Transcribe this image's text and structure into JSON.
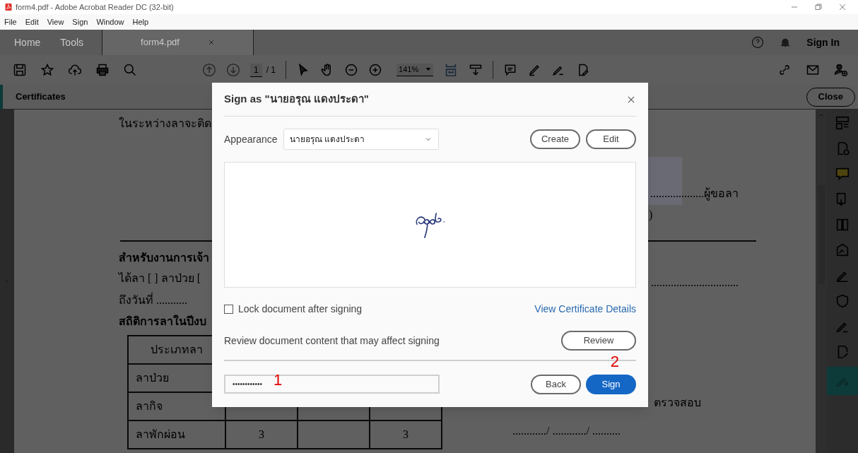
{
  "window": {
    "title": "form4.pdf - Adobe Acrobat Reader DC (32-bit)"
  },
  "menu": [
    "File",
    "Edit",
    "View",
    "Sign",
    "Window",
    "Help"
  ],
  "nav_tabs": [
    {
      "label": "Home",
      "selected": false
    },
    {
      "label": "Tools",
      "selected": false
    },
    {
      "label": "form4.pdf",
      "selected": true
    }
  ],
  "sign_in": "Sign In",
  "toolbar": {
    "page_current": "1",
    "page_total": "/ 1",
    "zoom": "141%"
  },
  "panel": {
    "title": "Certificates",
    "close": "Close"
  },
  "document": {
    "left_lines": [
      "ในระหว่างลาจะติด",
      "สำหรับงานการเจ้า",
      "ได้ลา [ ] ลาป่วย [",
      "ถึงวันที่ ...........",
      "สถิติการลาในปีงบ"
    ],
    "right_lines": [
      "...................ผู้ขอลา",
      ")",
      "...............................",
      "ตรวจสอบ",
      "............/ ............/ .........."
    ],
    "table": {
      "header": "ประเภทลา",
      "rows": [
        [
          "ลาป่วย",
          "",
          "",
          ""
        ],
        [
          "ลากิจ",
          "",
          "",
          ""
        ],
        [
          "ลาพักผ่อน",
          "3",
          "",
          "3"
        ]
      ]
    }
  },
  "dialog": {
    "title": "Sign as \"นายอรุณ แดงประดา\"",
    "appearance_label": "Appearance",
    "appearance_value": "นายอรุณ แดงประดา",
    "create": "Create",
    "edit": "Edit",
    "lock": {
      "label": "Lock document after signing",
      "checked": false
    },
    "view_certificate": "View Certificate Details",
    "review_text": "Review document content that may affect signing",
    "review": "Review",
    "password": "••••••••••••",
    "back": "Back",
    "sign": "Sign"
  },
  "annotations": [
    "1",
    "2"
  ]
}
